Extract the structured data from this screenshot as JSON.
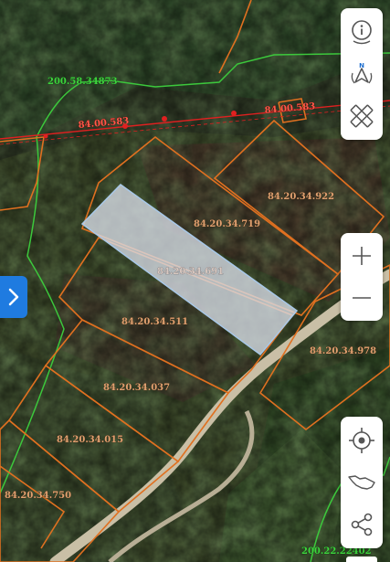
{
  "map": {
    "parcels": [
      {
        "id": "p719",
        "label": "84.20.34.719"
      },
      {
        "id": "p922",
        "label": "84.20.34.922"
      },
      {
        "id": "p691",
        "label": "84.20.34.691",
        "selected": true
      },
      {
        "id": "p511",
        "label": "84.20.34.511"
      },
      {
        "id": "p978",
        "label": "84.20.34.978"
      },
      {
        "id": "p037",
        "label": "84.20.34.037"
      },
      {
        "id": "p015",
        "label": "84.20.34.015"
      },
      {
        "id": "p750",
        "label": "84.20.34.750"
      }
    ],
    "road_label_left": "84.00.583",
    "road_label_right": "84.00.583",
    "green_label_top": "200.58.34873",
    "green_label_bottom": "200.22.22402",
    "colors": {
      "parcel_border": "#e07020",
      "selected_fill": "#d8dee8",
      "selected_border": "#a8c8e8",
      "green_boundary": "#3cc83c",
      "road_line": "#e02020",
      "accent": "#1f7be0"
    }
  },
  "controls": {
    "top": [
      "info-icon",
      "compass-icon",
      "measure-ruler-icon"
    ],
    "zoom": [
      "zoom-in-icon",
      "zoom-out-icon"
    ],
    "bottom": [
      "locate-me-icon",
      "country-map-icon",
      "share-icon"
    ],
    "side_toggle": "chevron-right-icon"
  }
}
